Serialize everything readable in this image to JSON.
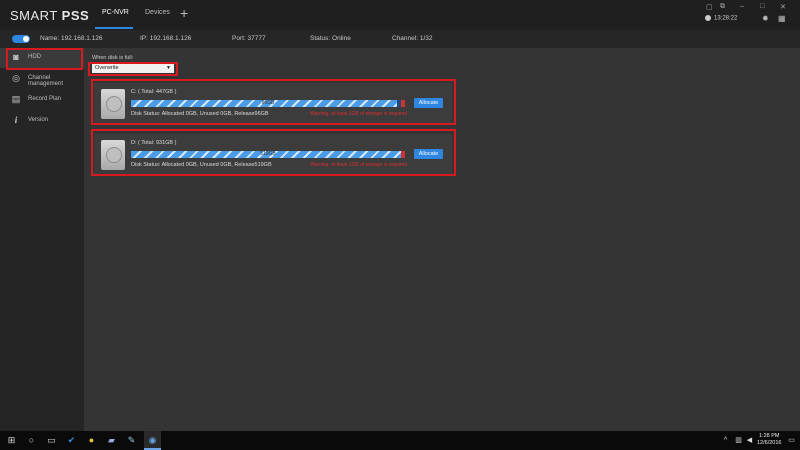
{
  "app": {
    "brand_light": "SMART ",
    "brand_bold": "PSS",
    "tabs": [
      {
        "label": "PC-NVR",
        "active": true
      },
      {
        "label": "Devices",
        "active": false
      }
    ],
    "add_tab": "+",
    "clock": "13:28:22"
  },
  "info": {
    "name": "Name:  192.168.1.126",
    "ip": "IP:  192.168.1.126",
    "port": "Port:  37777",
    "status": "Status:  Online",
    "channel": "Channel:  1/32"
  },
  "sidebar": {
    "items": [
      {
        "label": "HDD",
        "icon": "hdd-icon",
        "active": true
      },
      {
        "label": "Channel management",
        "icon": "camera-icon",
        "active": false
      },
      {
        "label": "Record Plan",
        "icon": "calendar-icon",
        "active": false
      },
      {
        "label": "Version",
        "icon": "info-icon",
        "active": false
      }
    ]
  },
  "main": {
    "when_full_label": "When disk is full:",
    "when_full_value": "Overwrite",
    "disks": [
      {
        "title": "C: ( Total: 447GB )",
        "bar_text": "96GB",
        "fill": 0.97,
        "allocate_label": "Allocate",
        "status": "Disk Status:  Allocated 0GB, Unused 0GB, Release96GB",
        "warning": "Warning: at least 1GB of storage is required"
      },
      {
        "title": "D: ( Total: 931GB )",
        "bar_text": "519GB",
        "fill": 0.99,
        "allocate_label": "Allocate",
        "status": "Disk Status:  Allocated 0GB, Unused 0GB, Release519GB",
        "warning": "Warning: at least 1GB of storage is required"
      }
    ]
  },
  "taskbar": {
    "time": "1:28 PM",
    "date": "12/6/2016"
  },
  "colors": {
    "accent": "#2f86e0",
    "highlight_box": "#d61a20",
    "warning": "#d83030"
  }
}
